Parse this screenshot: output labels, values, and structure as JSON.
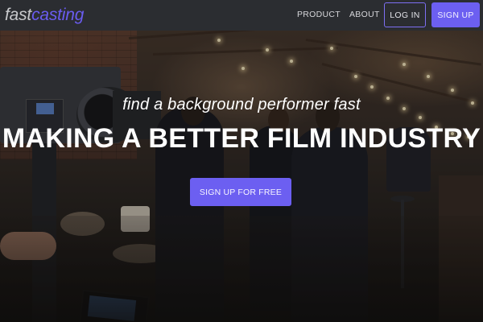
{
  "nav": {
    "logo_part1": "fast",
    "logo_part2": "casting",
    "product": "PRODUCT",
    "about": "ABOUT",
    "login": "LOG IN",
    "signup": "SIGN UP"
  },
  "hero": {
    "tagline": "find a background performer fast",
    "headline": "MAKING A BETTER FILM INDUSTRY",
    "cta": "SIGN UP FOR FREE"
  },
  "colors": {
    "navbar_bg": "#2b2d31",
    "accent": "#6c5ff1",
    "logo_light": "#c8c9cc"
  }
}
